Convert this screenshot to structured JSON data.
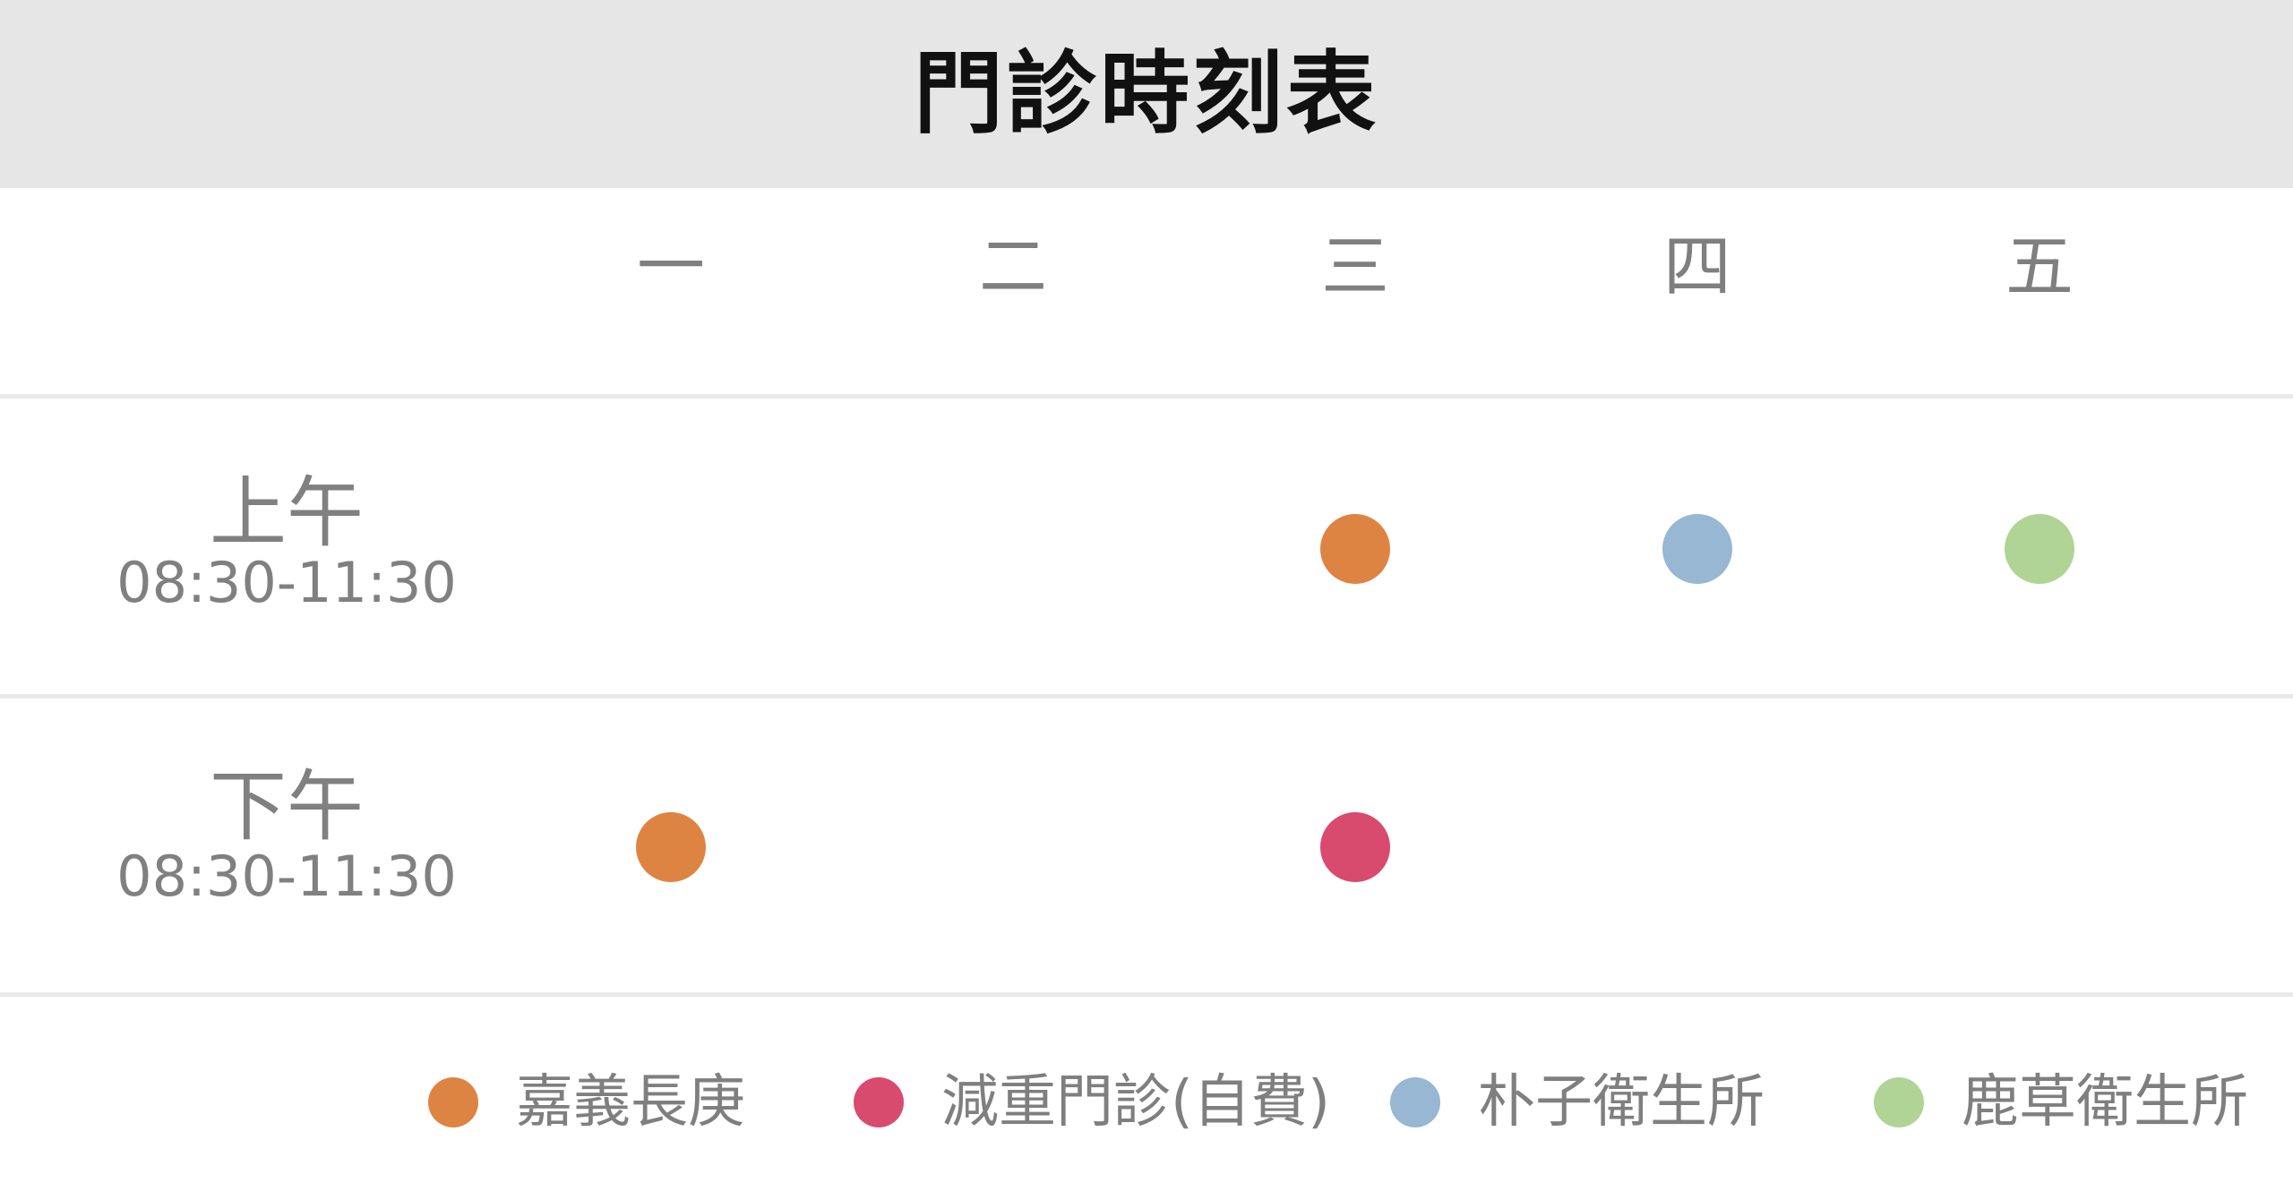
{
  "header": {
    "title": "門診時刻表"
  },
  "days": [
    "一",
    "二",
    "三",
    "四",
    "五"
  ],
  "sessions": [
    {
      "period": "上午",
      "hours": "08:30-11:30"
    },
    {
      "period": "下午",
      "hours": "08:30-11:30"
    }
  ],
  "legend": [
    {
      "label": "嘉義長庚",
      "color": "#de8443"
    },
    {
      "label": "減重門診(自費)",
      "color": "#d94a6f"
    },
    {
      "label": "朴子衛生所",
      "color": "#97b7d2"
    },
    {
      "label": "鹿草衛生所",
      "color": "#afd495"
    }
  ],
  "schedule": [
    {
      "session": "上午",
      "day": "三",
      "clinic": "嘉義長庚"
    },
    {
      "session": "上午",
      "day": "四",
      "clinic": "朴子衛生所"
    },
    {
      "session": "上午",
      "day": "五",
      "clinic": "鹿草衛生所"
    },
    {
      "session": "下午",
      "day": "一",
      "clinic": "嘉義長庚"
    },
    {
      "session": "下午",
      "day": "三",
      "clinic": "減重門診(自費)"
    }
  ]
}
